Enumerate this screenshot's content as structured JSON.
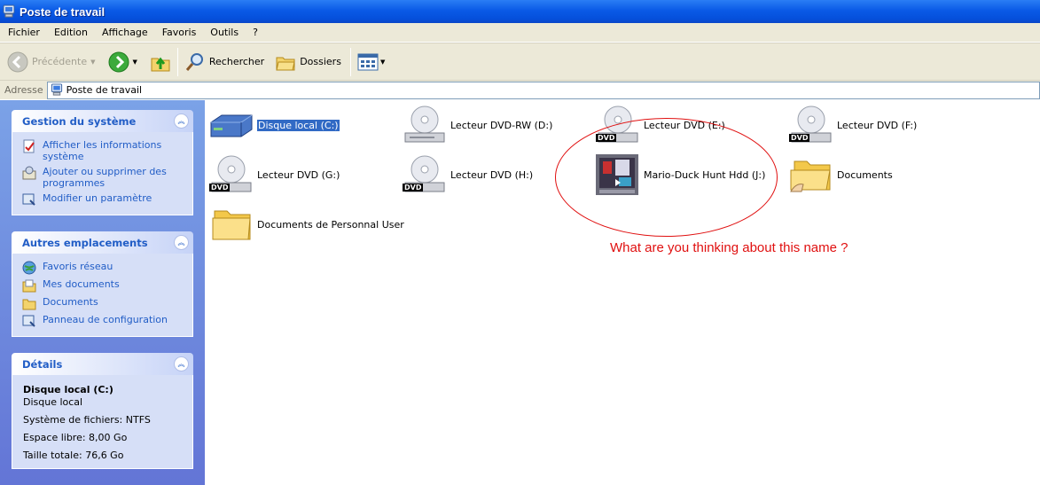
{
  "window": {
    "title": "Poste de travail"
  },
  "menu": [
    "Fichier",
    "Edition",
    "Affichage",
    "Favoris",
    "Outils",
    "?"
  ],
  "toolbar": {
    "back_label": "Précédente",
    "search_label": "Rechercher",
    "folders_label": "Dossiers"
  },
  "address": {
    "label": "Adresse",
    "value": "Poste de travail"
  },
  "panels": {
    "system": {
      "title": "Gestion du système",
      "links": [
        "Afficher les informations système",
        "Ajouter ou supprimer des programmes",
        "Modifier un paramètre"
      ]
    },
    "places": {
      "title": "Autres emplacements",
      "links": [
        "Favoris réseau",
        "Mes documents",
        "Documents",
        "Panneau de configuration"
      ]
    },
    "details": {
      "title": "Détails",
      "name": "Disque local (C:)",
      "type": "Disque local",
      "filesystem": "Système de fichiers: NTFS",
      "free": "Espace libre: 8,00 Go",
      "total": "Taille totale: 76,6 Go"
    }
  },
  "drives": [
    {
      "name": "Disque local (C:)",
      "icon": "hard-drive-icon",
      "selected": true
    },
    {
      "name": "Lecteur DVD-RW (D:)",
      "icon": "dvd-rw-drive-icon"
    },
    {
      "name": "Lecteur DVD (E:)",
      "icon": "dvd-drive-icon"
    },
    {
      "name": "Lecteur DVD (F:)",
      "icon": "dvd-drive-icon"
    },
    {
      "name": "Lecteur DVD (G:)",
      "icon": "dvd-drive-icon"
    },
    {
      "name": "Lecteur DVD (H:)",
      "icon": "dvd-drive-icon"
    },
    {
      "name": "Mario-Duck Hunt Hdd (J:)",
      "icon": "game-cartridge-icon"
    },
    {
      "name": "Documents",
      "icon": "shared-folder-icon"
    },
    {
      "name": "Documents de Personnal User",
      "icon": "folder-icon"
    }
  ],
  "dvd_badge": "DVD",
  "annotation": {
    "text": "What are you thinking about this name ?",
    "color": "#e01010"
  },
  "colors": {
    "title_bar": "#0a5ae6",
    "task_pane": "#6f8fdf",
    "link": "#215dc6",
    "selection": "#316ac5"
  }
}
